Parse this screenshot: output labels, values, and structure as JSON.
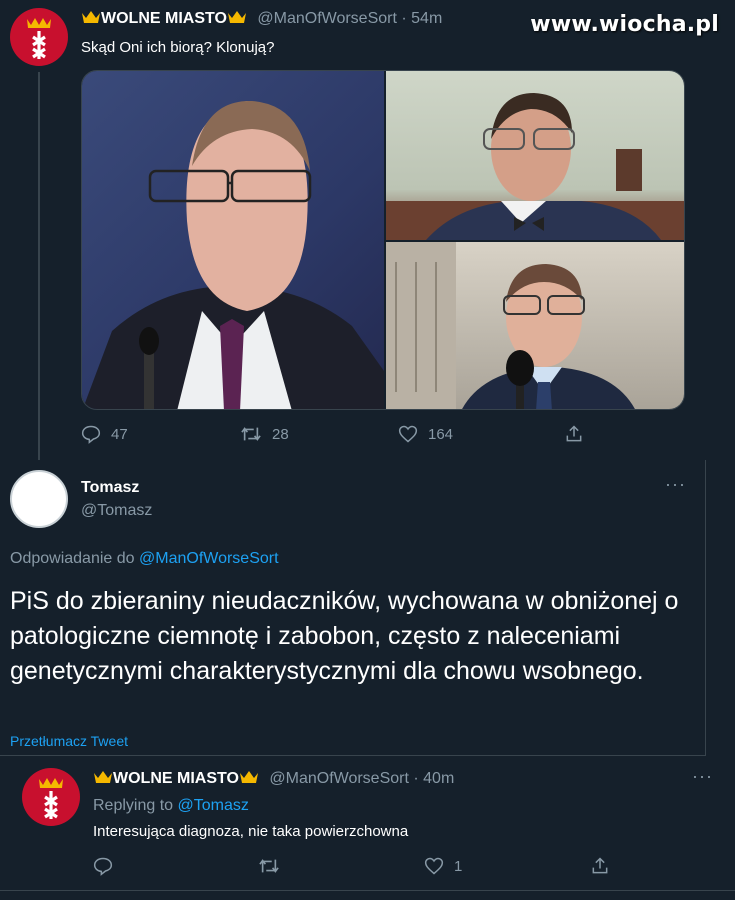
{
  "watermark": "www.wiocha.pl",
  "tweet1": {
    "display_name": "WOLNE MIASTO",
    "handle": "@ManOfWorseSort",
    "time": "54m",
    "text": "Skąd Oni ich biorą?  Klonują?",
    "replies": "47",
    "retweets": "28",
    "likes": "164"
  },
  "tweet2": {
    "display_name": "Tomasz",
    "handle": "@Tomasz",
    "replying_prefix": "Odpowiadanie do",
    "replying_to": "@ManOfWorseSort",
    "text": "PiS do zbieraniny nieudaczników, wychowana w obniżonej o patologiczne ciemnotę i zabobon, często z naleceniami genetycznymi charakterystycznymi dla chowu wsobnego.",
    "translate": "Przetłumacz Tweet"
  },
  "tweet3": {
    "display_name": "WOLNE MIASTO",
    "handle": "@ManOfWorseSort",
    "time": "40m",
    "replying_prefix": "Replying to",
    "replying_to": "@Tomasz",
    "text": "Interesująca diagnoza, nie taka powierzchowna",
    "likes": "1"
  },
  "colors": {
    "background": "#15202b",
    "accent": "#1da1f2",
    "muted": "#8899a6",
    "crest": "#c8102e",
    "crown": "#f5b800"
  }
}
